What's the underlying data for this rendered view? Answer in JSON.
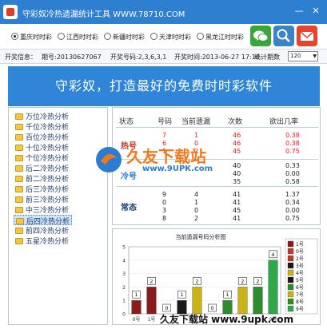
{
  "window": {
    "title": "守彩奴冷热遗漏统计工具 WWW.78710.COM",
    "minimize": "—",
    "close": "✕"
  },
  "regions": [
    {
      "label": "重庆时时彩",
      "selected": true
    },
    {
      "label": "江西时时彩",
      "selected": false
    },
    {
      "label": "新疆时时彩",
      "selected": false
    },
    {
      "label": "天津时时彩",
      "selected": false
    },
    {
      "label": "黑龙江时时彩",
      "selected": false
    }
  ],
  "tiles": {
    "wechat": "wechat-icon",
    "search": "search-icon",
    "mail": "mail-icon"
  },
  "info": {
    "label": "开奖信息：",
    "issue": "期号:20130627067",
    "numbers": "开奖号码:2,3,6,3,1",
    "time": "开奖时间:2013-06-27 17:10",
    "stat_label": "统计期数",
    "stat_value": "120"
  },
  "banner": "守彩奴，打造最好的免费时时彩软件",
  "sidebar": {
    "items": [
      "万位冷热分析",
      "千位冷热分析",
      "百位冷热分析",
      "十位冷热分析",
      "个位冷热分析",
      "后二冷热分析",
      "前二冷热分析",
      "后三冷热分析",
      "前三冷热分析",
      "中三冷热分析",
      "后四冷热分析",
      "前四冷热分析",
      "五星冷热分析"
    ],
    "selected_index": 10
  },
  "table": {
    "headers": [
      "状态",
      "号码",
      "当前遗漏",
      "次数",
      "欲出几率"
    ],
    "groups": [
      {
        "label": "热号",
        "rows": [
          {
            "num": "7",
            "miss": "1",
            "count": "46",
            "prob": "0.38"
          },
          {
            "num": "6",
            "miss": "0",
            "count": "46",
            "prob": "0.38"
          },
          {
            "num": "1",
            "miss": "2",
            "count": "45",
            "prob": "0.75"
          }
        ]
      },
      {
        "label": "冷号",
        "rows": [
          {
            "num": "",
            "miss": "",
            "count": "40",
            "prob": "0.33"
          },
          {
            "num": "",
            "miss": "",
            "count": "40",
            "prob": "0.00"
          },
          {
            "num": "",
            "miss": "",
            "count": "35",
            "prob": "0.58"
          }
        ]
      },
      {
        "label": "常态",
        "rows": [
          {
            "num": "9",
            "miss": "4",
            "count": "41",
            "prob": "1.37"
          },
          {
            "num": "0",
            "miss": "1",
            "count": "41",
            "prob": "0.34"
          },
          {
            "num": "3",
            "miss": "0",
            "count": "45",
            "prob": "0.00"
          },
          {
            "num": "8",
            "miss": "2",
            "count": "41",
            "prob": "0.75"
          }
        ]
      }
    ]
  },
  "watermark": {
    "text": "久友下载站",
    "url": "www.9UPK.com"
  },
  "footer_watermark": "久友下载站 www.9upk.com",
  "chart_data": {
    "type": "bar",
    "title": "当前遗漏号码分析图",
    "categories": [
      "0号",
      "1号",
      "2号",
      "3号",
      "4号",
      "5号",
      "6号",
      "7号",
      "8号",
      "9号"
    ],
    "values": [
      1,
      2,
      0,
      1,
      2,
      0,
      1,
      2,
      2,
      4
    ],
    "ylim": [
      0,
      5
    ],
    "yticks": [
      0,
      1,
      2,
      3,
      4,
      5
    ],
    "x_tick_labels_visible": [
      "0号",
      "1号",
      "9号"
    ],
    "colors": [
      "#8b1a1a",
      "#8b1a1a",
      "#c0392b",
      "#1a1a1a",
      "#c9b21a",
      "#1a1a1a",
      "#2e8b2e",
      "#c9b21a",
      "#2e8b2e",
      "#2fa84a"
    ],
    "legend": [
      "1号",
      "0号",
      "2号",
      "3号",
      "4号",
      "5号",
      "6号",
      "7号",
      "8号",
      "9号"
    ],
    "legend_colors": [
      "#8b1a1a",
      "#c0392b",
      "#c0392b",
      "#1a1a1a",
      "#c9b21a",
      "#1a1a1a",
      "#2e8b2e",
      "#c9b21a",
      "#2e8b2e",
      "#2fa84a"
    ],
    "legend_placement": "right",
    "grid": true
  }
}
